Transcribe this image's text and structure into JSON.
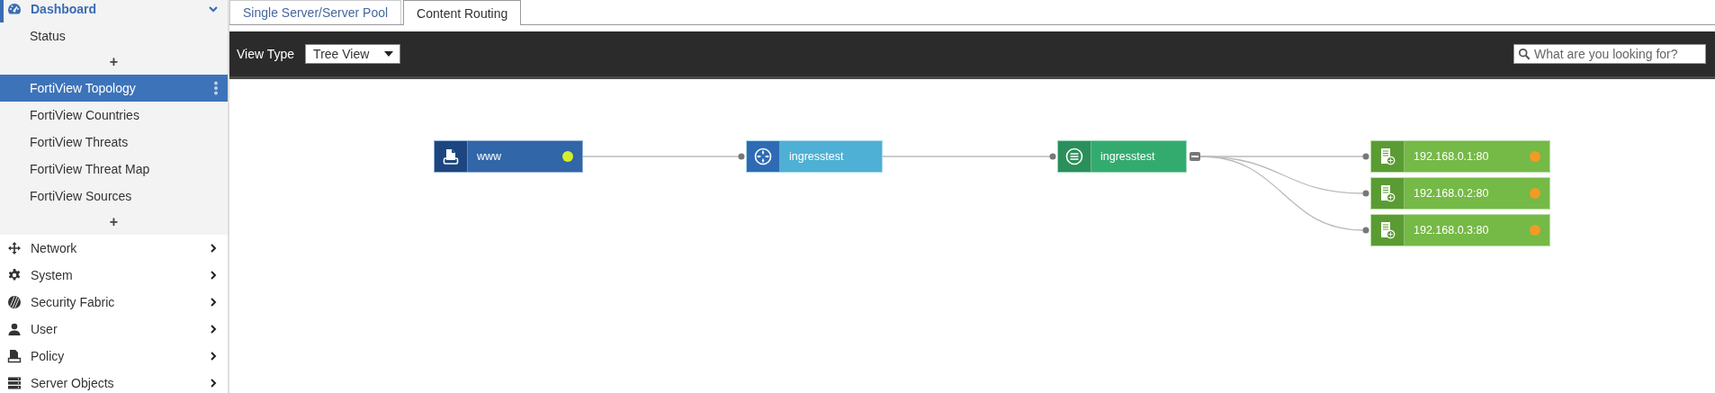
{
  "sidebar": {
    "items": [
      {
        "kind": "group",
        "label": "Dashboard",
        "expanded": true,
        "children": [
          {
            "kind": "link",
            "label": "Status",
            "selected": false
          },
          {
            "kind": "add",
            "label": "+"
          },
          {
            "kind": "link",
            "label": "FortiView Topology",
            "selected": true
          },
          {
            "kind": "link",
            "label": "FortiView Countries",
            "selected": false
          },
          {
            "kind": "link",
            "label": "FortiView Threats",
            "selected": false
          },
          {
            "kind": "link",
            "label": "FortiView Threat Map",
            "selected": false
          },
          {
            "kind": "link",
            "label": "FortiView Sources",
            "selected": false
          },
          {
            "kind": "add",
            "label": "+"
          }
        ]
      },
      {
        "kind": "group",
        "label": "Network",
        "expanded": false
      },
      {
        "kind": "group",
        "label": "System",
        "expanded": false
      },
      {
        "kind": "group",
        "label": "Security Fabric",
        "expanded": false
      },
      {
        "kind": "group",
        "label": "User",
        "expanded": false
      },
      {
        "kind": "group",
        "label": "Policy",
        "expanded": false
      },
      {
        "kind": "group",
        "label": "Server Objects",
        "expanded": false
      }
    ]
  },
  "tabs": [
    {
      "label": "Single Server/Server Pool",
      "selected": false
    },
    {
      "label": "Content Routing",
      "selected": true
    }
  ],
  "toolbar": {
    "view_type_label": "View Type",
    "view_type": {
      "value": "Tree View"
    },
    "search": {
      "placeholder": "What are you looking for?"
    }
  },
  "topology": {
    "root": {
      "kind": "source",
      "label": "www",
      "color": "#d4f02a",
      "children": [
        {
          "kind": "ingress",
          "label": "ingresstest",
          "children": [
            {
              "kind": "content",
              "label": "ingresstest",
              "expanded": true,
              "children": [
                {
                  "kind": "server",
                  "label": "192.168.0.1:80",
                  "color": "#f39a26"
                },
                {
                  "kind": "server",
                  "label": "192.168.0.2:80",
                  "color": "#f39a26"
                },
                {
                  "kind": "server",
                  "label": "192.168.0.3:80",
                  "color": "#f39a26"
                }
              ]
            }
          ]
        }
      ]
    }
  }
}
